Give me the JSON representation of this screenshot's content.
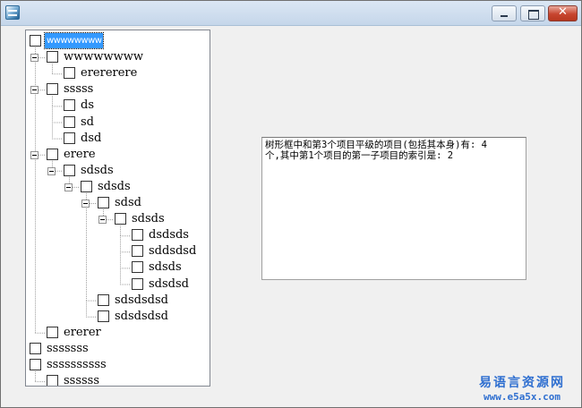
{
  "window": {
    "title": "",
    "icon": "app-icon",
    "controls": [
      "minimize-icon",
      "maximize-icon",
      "close-icon"
    ],
    "close_glyph": "✕"
  },
  "tree": {
    "nodes": [
      {
        "label": "wwwwwwww",
        "depth": 0,
        "toggle": false,
        "selected": true
      },
      {
        "label": "wwwwwwww",
        "depth": 1,
        "toggle": true
      },
      {
        "label": "erererere",
        "depth": 2,
        "toggle": false
      },
      {
        "label": "sssss",
        "depth": 1,
        "toggle": true
      },
      {
        "label": "ds",
        "depth": 2,
        "toggle": false
      },
      {
        "label": "sd",
        "depth": 2,
        "toggle": false
      },
      {
        "label": "dsd",
        "depth": 2,
        "toggle": false
      },
      {
        "label": "erere",
        "depth": 1,
        "toggle": true
      },
      {
        "label": "sdsds",
        "depth": 2,
        "toggle": true
      },
      {
        "label": "sdsds",
        "depth": 3,
        "toggle": true
      },
      {
        "label": "sdsd",
        "depth": 4,
        "toggle": true
      },
      {
        "label": "sdsds",
        "depth": 5,
        "toggle": true
      },
      {
        "label": "dsdsds",
        "depth": 6,
        "toggle": false
      },
      {
        "label": "sddsdsd",
        "depth": 6,
        "toggle": false
      },
      {
        "label": "sdsds",
        "depth": 6,
        "toggle": false
      },
      {
        "label": "sdsdsd",
        "depth": 6,
        "toggle": false
      },
      {
        "label": "sdsdsdsd",
        "depth": 4,
        "toggle": false
      },
      {
        "label": "sdsdsdsd",
        "depth": 4,
        "toggle": false
      },
      {
        "label": "ererer",
        "depth": 1,
        "toggle": false
      },
      {
        "label": "sssssss",
        "depth": 0,
        "toggle": false
      },
      {
        "label": "ssssssssss",
        "depth": 0,
        "toggle": false
      },
      {
        "label": "ssssss",
        "depth": 1,
        "toggle": false
      }
    ]
  },
  "output": {
    "line1": "树形框中和第3个项目平级的项目(包括其本身)有: 4",
    "line2": "个,其中第1个项目的第一子项目的索引是: 2"
  },
  "watermark": {
    "name": "易语言资源网",
    "url": "www.e5a5x.com",
    "color": "#2f6fd0"
  }
}
